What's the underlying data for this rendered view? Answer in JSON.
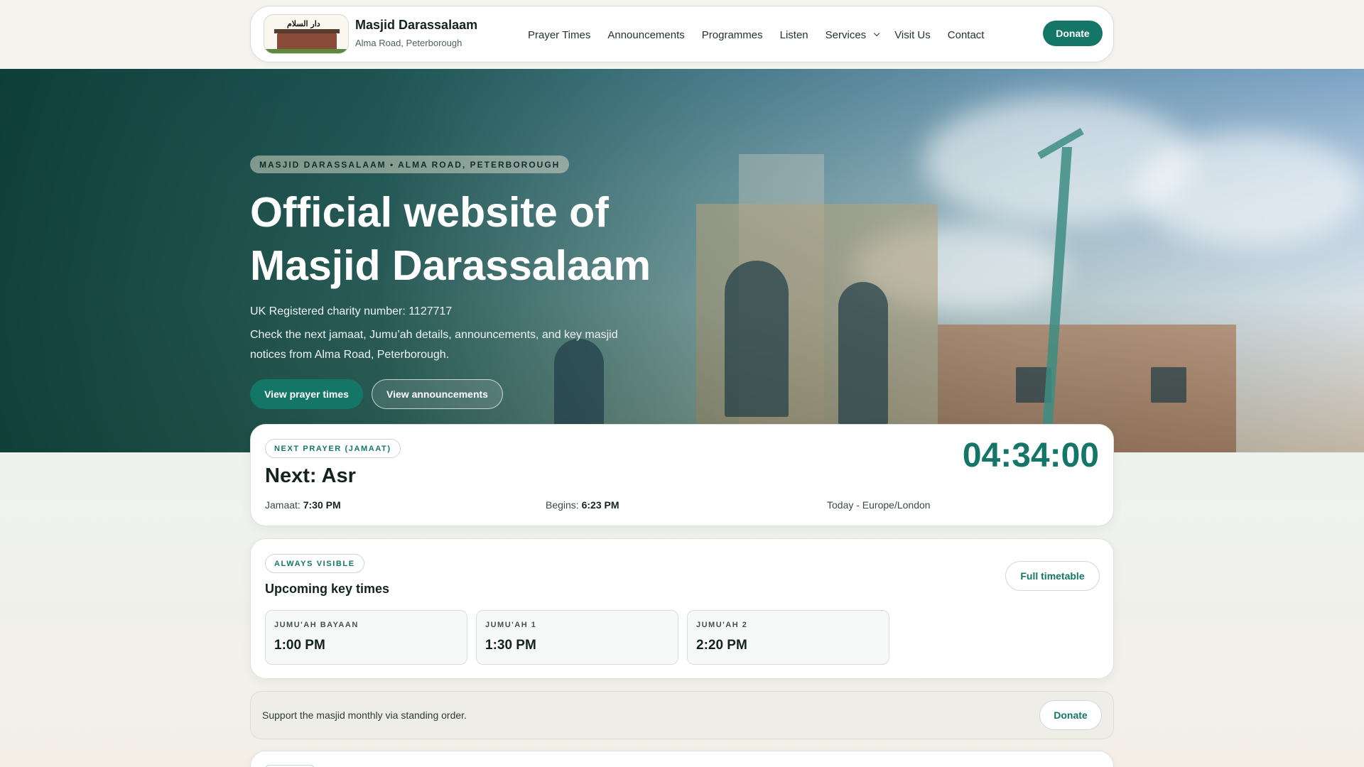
{
  "header": {
    "brand_name": "Masjid Darassalaam",
    "brand_sub": "Alma Road, Peterborough",
    "logo_text": "دار السلام",
    "nav": [
      "Prayer Times",
      "Announcements",
      "Programmes",
      "Listen",
      "Services",
      "Visit Us",
      "Contact"
    ],
    "donate": "Donate"
  },
  "hero": {
    "eyebrow": "MASJID DARASSALAAM • ALMA ROAD, PETERBOROUGH",
    "title": "Official website of Masjid Darassalaam",
    "charity": "UK Registered charity number: 1127717",
    "description": "Check the next jamaat, Jumu’ah details, announcements, and key masjid notices from Alma Road, Peterborough.",
    "btn_primary": "View prayer times",
    "btn_secondary": "View announcements"
  },
  "next_prayer": {
    "badge": "NEXT PRAYER (JAMAAT)",
    "title": "Next: Asr",
    "countdown": "04:34:00",
    "jamaat_label": "Jamaat:",
    "jamaat_time": "7:30 PM",
    "begins_label": "Begins:",
    "begins_time": "6:23 PM",
    "timezone": "Today - Europe/London"
  },
  "key_times": {
    "badge": "ALWAYS VISIBLE",
    "title": "Upcoming key times",
    "full_timetable": "Full timetable",
    "tiles": [
      {
        "label": "JUMU'AH BAYAAN",
        "time": "1:00 PM"
      },
      {
        "label": "JUMU'AH 1",
        "time": "1:30 PM"
      },
      {
        "label": "JUMU'AH 2",
        "time": "2:20 PM"
      }
    ]
  },
  "support": {
    "text": "Support the masjid monthly via standing order.",
    "donate": "Donate"
  },
  "colors": {
    "accent": "#147667",
    "hero_overlay": "#0a3a34",
    "page_bg": "#f4f2ec"
  },
  "icons": {
    "services_dropdown": "chevron-down-icon"
  }
}
